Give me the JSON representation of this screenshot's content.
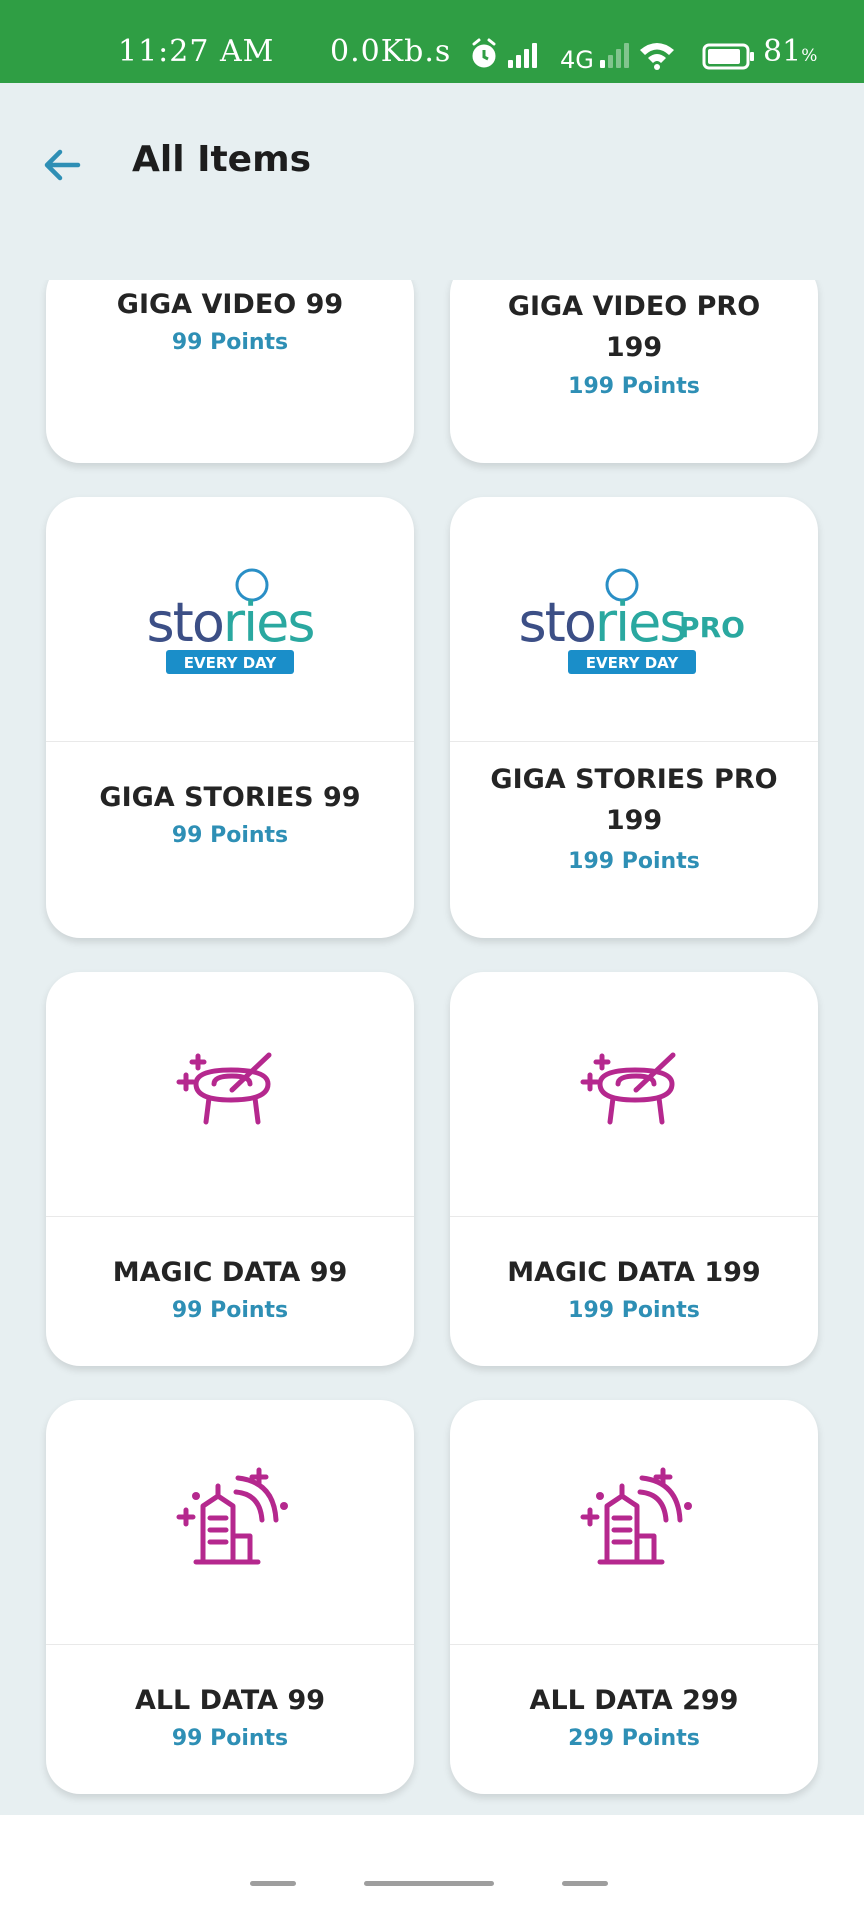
{
  "status_bar": {
    "time": "11:27 AM",
    "speed": "0.0Kb.s",
    "network": "4G",
    "battery": "81",
    "battery_unit": "%"
  },
  "header": {
    "title": "All Items",
    "back_icon": "arrow-left-icon"
  },
  "colors": {
    "status_bar": "#2f9e44",
    "background": "#e7eff1",
    "points": "#2e8fb5",
    "icon_magenta": "#b5288e",
    "back_arrow": "#2e8fb5"
  },
  "items": [
    {
      "title": "GIGA VIDEO 99",
      "points": "99 Points"
    },
    {
      "title": "GIGA VIDEO PRO",
      "title2": "199",
      "points": "199 Points"
    },
    {
      "title": "GIGA STORIES 99",
      "points": "99 Points",
      "logo_word": "stories",
      "logo_tag": "EVERY DAY"
    },
    {
      "title": "GIGA STORIES PRO",
      "title2": "199",
      "points": "199 Points",
      "logo_word": "stories",
      "logo_suffix": "PRO",
      "logo_tag": "EVERY DAY"
    },
    {
      "title": "MAGIC DATA 99",
      "points": "99 Points",
      "icon": "magic-data-icon"
    },
    {
      "title": "MAGIC DATA 199",
      "points": "199 Points",
      "icon": "magic-data-icon"
    },
    {
      "title": "ALL DATA 99",
      "points": "99 Points",
      "icon": "all-data-icon"
    },
    {
      "title": "ALL DATA 299",
      "points": "299 Points",
      "icon": "all-data-icon"
    }
  ]
}
